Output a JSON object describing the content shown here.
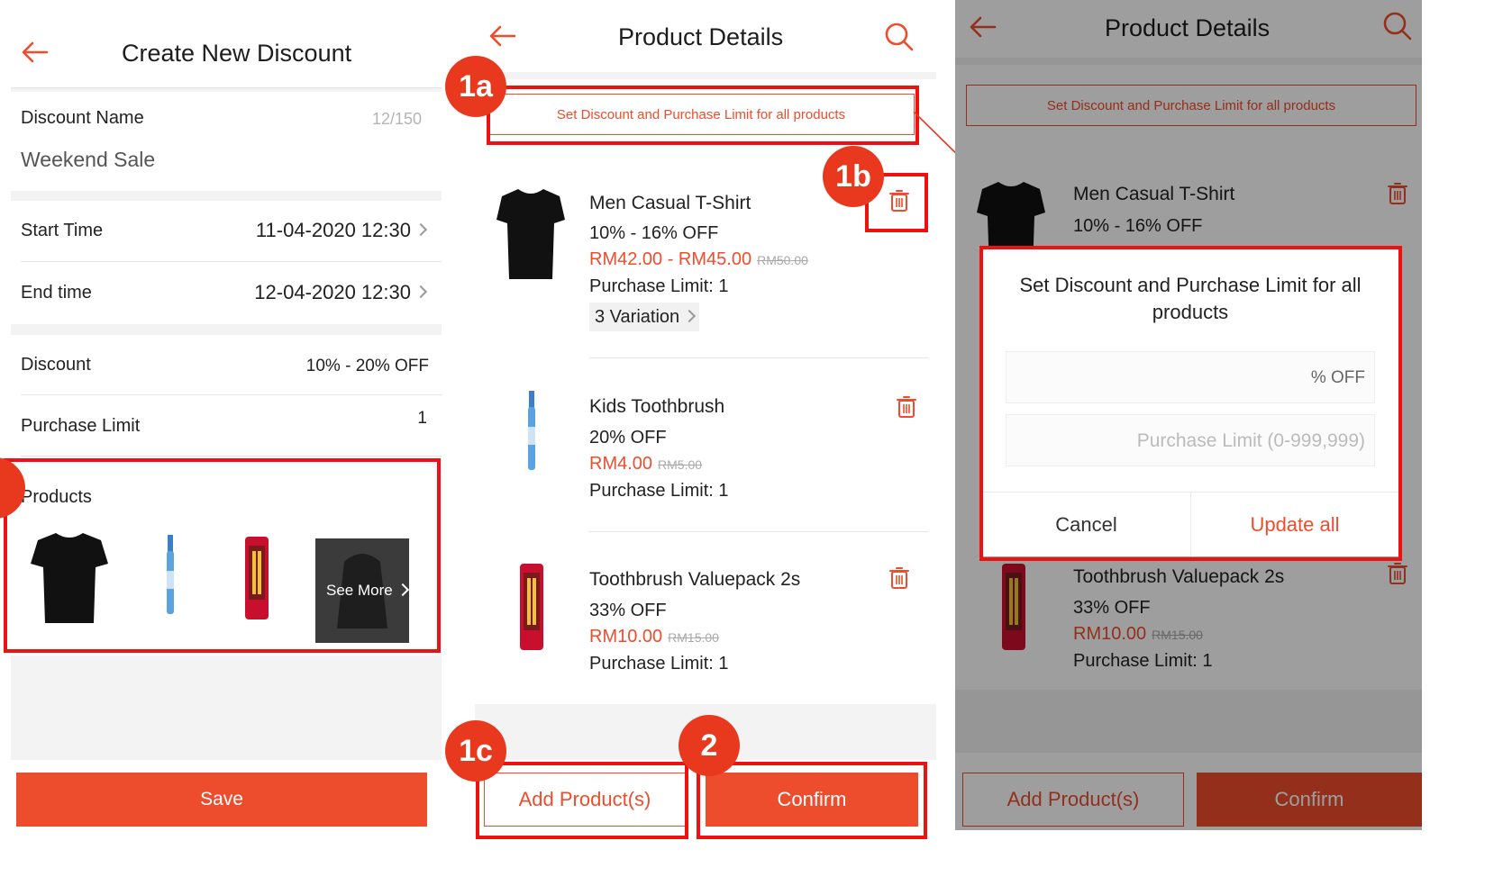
{
  "screen1": {
    "header_title": "Create New Discount",
    "discount_name_label": "Discount Name",
    "discount_name_count": "12/150",
    "discount_name_value": "Weekend Sale",
    "start_time_label": "Start Time",
    "start_time_value": "11-04-2020 12:30",
    "end_time_label": "End time",
    "end_time_value": "12-04-2020 12:30",
    "discount_label": "Discount",
    "discount_value": "10% - 20% OFF",
    "purchase_limit_label": "Purchase Limit",
    "purchase_limit_value": "1",
    "products_label": "Products",
    "see_more_label": "See More",
    "save_label": "Save"
  },
  "screen2": {
    "header_title": "Product Details",
    "set_all_label": "Set Discount and Purchase Limit for all products",
    "products": [
      {
        "name": "Men Casual T-Shirt",
        "discount": "10% - 16% OFF",
        "price": "RM42.00 - RM45.00",
        "original_price": "RM50.00",
        "limit": "Purchase Limit: 1",
        "variation": "3 Variation"
      },
      {
        "name": "Kids Toothbrush",
        "discount": "20% OFF",
        "price": "RM4.00",
        "original_price": "RM5.00",
        "limit": "Purchase Limit: 1"
      },
      {
        "name": "Toothbrush Valuepack 2s",
        "discount": "33% OFF",
        "price": "RM10.00",
        "original_price": "RM15.00",
        "limit": "Purchase Limit: 1"
      }
    ],
    "add_products_label": "Add Product(s)",
    "confirm_label": "Confirm"
  },
  "screen3": {
    "header_title": "Product Details",
    "set_all_label": "Set Discount and Purchase Limit for all products",
    "products": [
      {
        "name": "Men Casual T-Shirt",
        "discount": "10% - 16% OFF"
      },
      {
        "name": "Toothbrush Valuepack 2s",
        "discount": "33% OFF",
        "price": "RM10.00",
        "original_price": "RM15.00",
        "limit": "Purchase Limit: 1"
      }
    ],
    "dialog": {
      "title": "Set Discount and Purchase Limit for all products",
      "discount_placeholder": "% OFF",
      "limit_placeholder": "Purchase Limit (0-999,999)",
      "cancel_label": "Cancel",
      "update_label": "Update all"
    },
    "add_products_label": "Add Product(s)",
    "confirm_label": "Confirm"
  },
  "badges": {
    "b1a": "1a",
    "b1b": "1b",
    "b1c": "1c",
    "b2": "2"
  },
  "colors": {
    "brand_orange": "#ee4d2d",
    "highlight_red": "#ee1111",
    "badge_red": "#e8391e"
  }
}
